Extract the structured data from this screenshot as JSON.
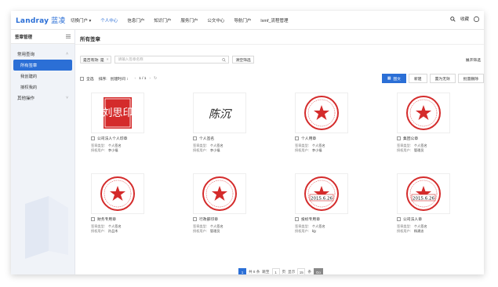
{
  "app": {
    "logo_en": "Landray",
    "logo_cn": "蓝凌"
  },
  "nav": [
    "切换门户 ▾",
    "个人中心",
    "信息门户",
    "知识门户",
    "服务门户",
    "公文中心",
    "导航门户",
    "lxmf_流程管理"
  ],
  "topright": {
    "fav": "收藏"
  },
  "sidebar": {
    "header": "签章管理",
    "group1": "常用查询",
    "items": [
      "所有签章",
      "我创建的",
      "授权我的"
    ],
    "group2": "其他操作"
  },
  "main": {
    "title": "所有签章"
  },
  "filter": {
    "chip": "是否有效: 是",
    "search_placeholder": "请输入签章名称",
    "clear": "清空筛选",
    "expand": "展开筛选"
  },
  "toolbar": {
    "select_all": "全选",
    "sort": "排序:",
    "created": "创建时间 ↕",
    "page": "1 / 1",
    "view": "图文",
    "new": "新建",
    "invalid": "置为无效",
    "batch": "批量删除"
  },
  "meta_labels": {
    "type": "签章类型:",
    "user": "授权用户:"
  },
  "cards": [
    {
      "name": "公司法人个人印章",
      "type": "个人签名",
      "user": "李小福",
      "seal": "square",
      "text": "刘思印"
    },
    {
      "name": "个人签名",
      "type": "个人签名",
      "user": "李小福",
      "seal": "sign",
      "text": "陈沉"
    },
    {
      "name": "个人用章",
      "type": "个人签名",
      "user": "李小福",
      "seal": "round",
      "text": ""
    },
    {
      "name": "集团公章",
      "type": "个人签名",
      "user": "管理员",
      "seal": "round",
      "text": ""
    },
    {
      "name": "财务专用章",
      "type": "个人签名",
      "user": "孙品木",
      "seal": "round",
      "text": ""
    },
    {
      "name": "行政部印章",
      "type": "个人签名",
      "user": "管理员",
      "seal": "round",
      "text": ""
    },
    {
      "name": "投标专用章",
      "type": "个人签名",
      "user": "bjy",
      "seal": "date",
      "text": "2015.6.26"
    },
    {
      "name": "公司法人章",
      "type": "个人签名",
      "user": "杨建忠",
      "seal": "date",
      "text": "2015.6.26"
    }
  ],
  "pager": {
    "current": "1",
    "total": "共 8 条",
    "jump": "跳至",
    "page_val": "1",
    "page_unit": "页",
    "show": "显示",
    "size": "15",
    "size_unit": "条",
    "go": "Go"
  },
  "colors": {
    "accent": "#2b6fd6",
    "seal": "#d42b2b"
  }
}
